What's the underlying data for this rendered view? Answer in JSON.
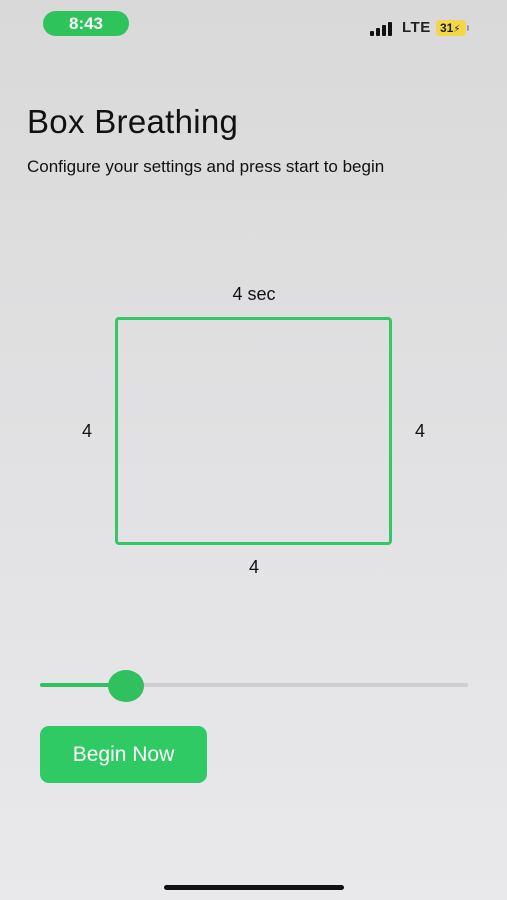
{
  "status_bar": {
    "time": "8:43",
    "network": "LTE",
    "battery": "31",
    "charging_glyph": "⚡",
    "time_pill_color": "#2fc35c",
    "battery_color": "#f4d64a",
    "signal_icon": "signal-bars-icon",
    "battery_icon": "battery-charging-icon"
  },
  "header": {
    "title": "Box Breathing",
    "subtitle": "Configure your settings and press start to begin"
  },
  "box": {
    "top_label": "4 sec",
    "left_label": "4",
    "right_label": "4",
    "bottom_label": "4",
    "stroke_color": "#34c767"
  },
  "slider": {
    "fraction": 0.2,
    "fill_color": "#30c05d"
  },
  "actions": {
    "begin_label": "Begin Now",
    "accent_color": "#2fca63"
  }
}
